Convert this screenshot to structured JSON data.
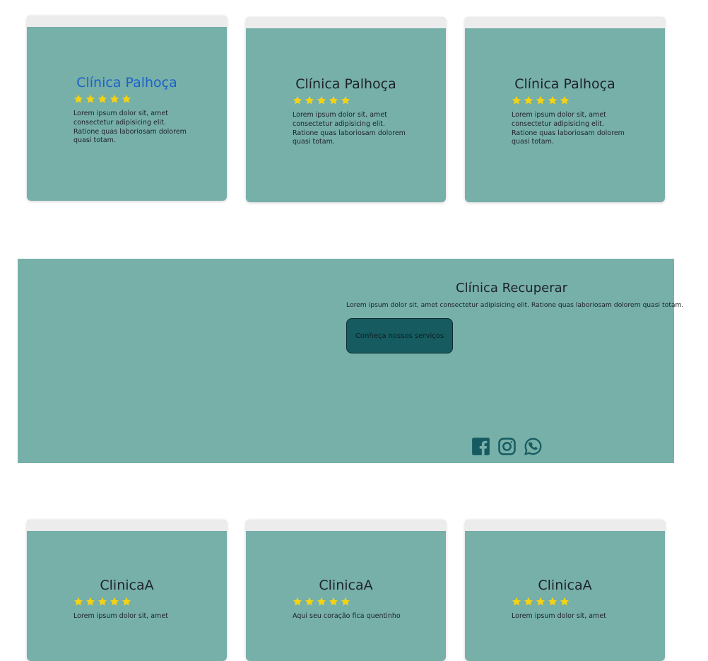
{
  "colors": {
    "card_bg": "#77afa9",
    "card_topbar": "#ececec",
    "button_bg": "#155b60",
    "star": "#f5d312",
    "icon": "#155b60",
    "title_link": "#1a63c8"
  },
  "rows": [
    {
      "cards": [
        {
          "title": "Clínica Palhoça",
          "rating": 5,
          "text": "Lorem ipsum dolor sit, amet consectetur adipisicing elit. Ratione quas laboriosam dolorem quasi totam."
        },
        {
          "title": "Clínica Palhoça",
          "rating": 5,
          "text": "Lorem ipsum dolor sit, amet consectetur adipisicing elit. Ratione quas laboriosam dolorem quasi totam."
        },
        {
          "title": "Clínica Palhoça",
          "rating": 5,
          "text": "Lorem ipsum dolor sit, amet consectetur adipisicing elit. Ratione quas laboriosam dolorem quasi totam."
        }
      ]
    },
    {
      "cards": [
        {
          "title": "ClinicaA",
          "rating": 5,
          "text": "Lorem ipsum dolor sit, amet"
        },
        {
          "title": "ClinicaA",
          "rating": 5,
          "text": "Aqui seu coração fica quentinho"
        },
        {
          "title": "ClinicaA",
          "rating": 5,
          "text": "Lorem ipsum dolor sit, amet"
        }
      ]
    }
  ],
  "banner": {
    "title": "Clínica Recuperar",
    "description": "Lorem ipsum dolor sit, amet consectetur adipisicing elit. Ratione quas laboriosam dolorem quasi totam.",
    "button_label": "Conheça nossos serviços",
    "social_icons": [
      "facebook-icon",
      "instagram-icon",
      "whatsapp-icon"
    ]
  }
}
